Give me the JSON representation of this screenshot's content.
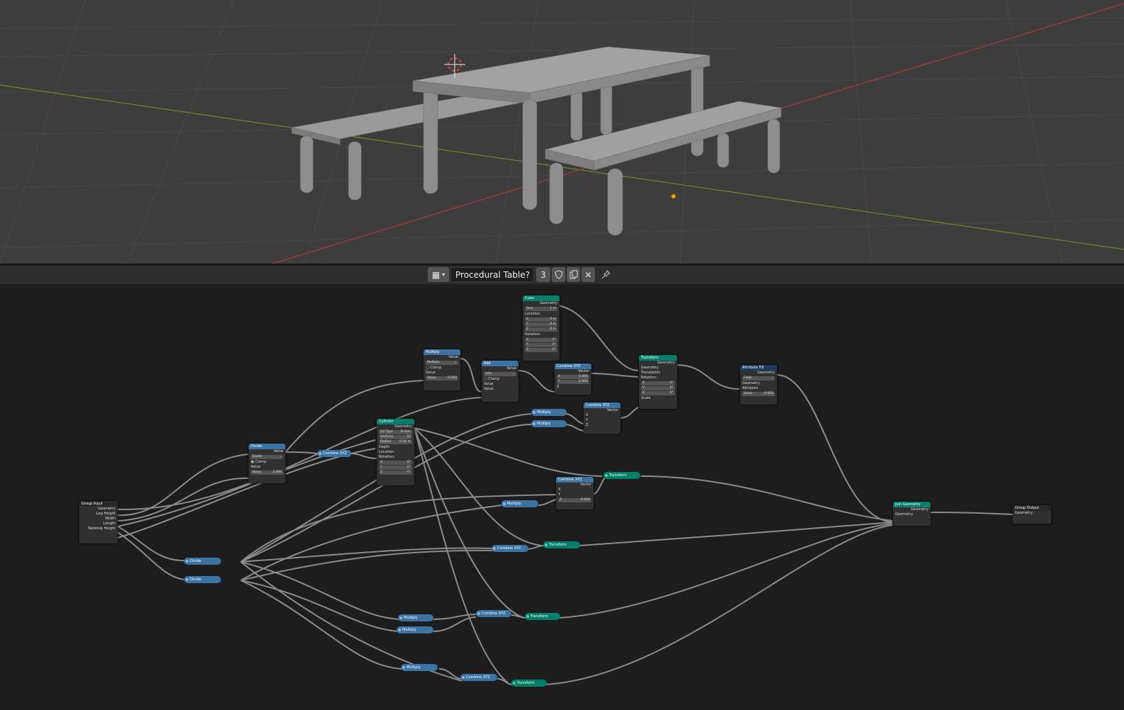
{
  "header": {
    "node_tree_name": "Procedural Table?",
    "user_count": "3",
    "icons": [
      "node-tree-editor-icon",
      "chevron-down-icon",
      "fake-user-shield-icon",
      "duplicate-icon",
      "close-icon",
      "pin-icon"
    ]
  },
  "nodes": {
    "group_input": {
      "title": "Group Input",
      "outputs": [
        "Geometry",
        "Leg Height",
        "Width",
        "Length",
        "Tabletop Height"
      ]
    },
    "group_output": {
      "title": "Group Output",
      "inputs": [
        "Geometry"
      ]
    },
    "cube": {
      "title": "Cube",
      "out": "Geometry",
      "size_label": "Size",
      "size_value": "1 m",
      "location_label": "Location:",
      "rotation_label": "Rotation:",
      "x": "X",
      "y": "Y",
      "z": "Z",
      "loc_x": "0 m",
      "loc_y": "0 m",
      "loc_z": "0 m",
      "rot_x": "0°",
      "rot_y": "0°",
      "rot_z": "0°"
    },
    "multiply_top": {
      "title": "Multiply",
      "out": "Value",
      "op": "Multiply",
      "clamp": "Clamp",
      "in_value": "Value",
      "value_label": "Value",
      "value": "0.500"
    },
    "add": {
      "title": "Add",
      "out": "Value",
      "op": "Add",
      "clamp": "Clamp",
      "in1": "Value",
      "in2": "Value"
    },
    "combine_top": {
      "title": "Combine XYZ",
      "out": "Vector",
      "x": "X",
      "x_val": "0.000",
      "y": "Y",
      "y_val": "0.000",
      "z": "Z"
    },
    "transform_top": {
      "title": "Transform",
      "out": "Geometry",
      "geometry": "Geometry",
      "translation": "Translation",
      "rotation": "Rotation:",
      "x": "X",
      "y": "Y",
      "z": "Z",
      "rx": "0°",
      "ry": "0°",
      "rz": "0°",
      "scale": "Scale"
    },
    "attribute_fill": {
      "title": "Attribute Fill",
      "out": "Geometry",
      "type": "Float",
      "geometry": "Geometry",
      "attribute": "Attribute",
      "value_label": "Value",
      "value": "0.000"
    },
    "combine_mid": {
      "title": "Combine XYZ",
      "out": "Vector",
      "x": "X",
      "y": "Y",
      "z": "Z"
    },
    "divide": {
      "title": "Divide",
      "out": "Value",
      "op": "Divide",
      "clamp": "Clamp",
      "in_value": "Value",
      "value_label": "Value",
      "value": "2.000"
    },
    "combine_small": {
      "title": "Combine XYZ"
    },
    "cylinder": {
      "title": "Cylinder",
      "out": "Geometry",
      "fill_label": "Fill Type",
      "fill_value": "N-Gon",
      "vertices_label": "Vertices",
      "vertices_value": "32",
      "radius_label": "Radius",
      "radius_value": "0.04 m",
      "depth": "Depth",
      "location": "Location",
      "rotation": "Rotation:",
      "x": "X",
      "y": "Y",
      "z": "Z",
      "rx": "0°",
      "ry": "0°",
      "rz": "0°"
    },
    "combine_low": {
      "title": "Combine XYZ",
      "out": "Vector",
      "x": "X",
      "y": "Y",
      "z": "Z",
      "z_val": "0.000"
    },
    "join_geometry": {
      "title": "Join Geometry",
      "out": "Geometry",
      "in": "Geometry"
    }
  },
  "pills": {
    "multiply_a": "Multiply",
    "multiply_b": "Multiply",
    "transform_1": "Transform",
    "multiply_c": "Multiply",
    "combine_2": "Combine XYZ",
    "transform_2": "Transform",
    "divide_a": "Divide",
    "divide_b": "Divide",
    "multiply_d": "Multiply",
    "multiply_e": "Multiply",
    "combine_3": "Combine XYZ",
    "transform_3": "Transform",
    "multiply_f": "Multiply",
    "combine_4": "Combine XYZ",
    "transform_4": "Transform"
  },
  "colors": {
    "geometry_header": "#00806b",
    "math_header": "#3b74a3",
    "attribute_header": "#1f3b63",
    "viewport_bg": "#3d3d3d",
    "editor_bg": "#1d1d1d"
  }
}
